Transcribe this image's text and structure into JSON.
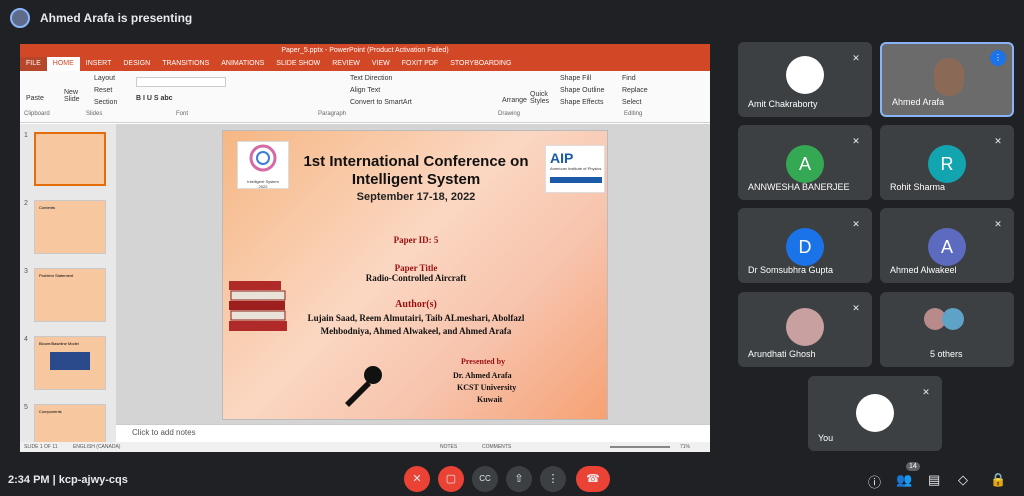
{
  "presenter": {
    "label": "Ahmed Arafa is presenting"
  },
  "powerpoint": {
    "window_title": "Paper_5.pptx - PowerPoint (Product Activation Failed)",
    "tabs": [
      "FILE",
      "HOME",
      "INSERT",
      "DESIGN",
      "TRANSITIONS",
      "ANIMATIONS",
      "SLIDE SHOW",
      "REVIEW",
      "VIEW",
      "FOXIT PDF",
      "STORYBOARDING"
    ],
    "ribbon": {
      "paste": "Paste",
      "new_slide": "New Slide",
      "layout": "Layout",
      "reset": "Reset",
      "section": "Section",
      "text_direction": "Text Direction",
      "align_text": "Align Text",
      "convert_smartart": "Convert to SmartArt",
      "arrange": "Arrange",
      "quick_styles": "Quick Styles",
      "shape_fill": "Shape Fill",
      "shape_outline": "Shape Outline",
      "shape_effects": "Shape Effects",
      "find": "Find",
      "replace": "Replace",
      "select": "Select",
      "groups": [
        "Clipboard",
        "Slides",
        "Font",
        "Paragraph",
        "Drawing",
        "Editing"
      ]
    },
    "thumbnail_numbers": [
      "1",
      "2",
      "3",
      "4",
      "5"
    ],
    "thumbnail_texts": [
      "Contents",
      "Problem Statement",
      "Bloom/Baseline Model",
      "Components"
    ],
    "notes_placeholder": "Click to add notes",
    "status": {
      "slide": "SLIDE 1 OF 11",
      "language": "ENGLISH (CANADA)",
      "notes": "NOTES",
      "comments": "COMMENTS",
      "zoom": "71%"
    }
  },
  "slide": {
    "logo_left": "Intelligent System",
    "logo_left_year": "2022",
    "logo_right": "AIP",
    "logo_right_sub": "American Institute of Physics",
    "title_line1": "1st International Conference on",
    "title_line2": "Intelligent System",
    "date": "September 17-18, 2022",
    "paper_id": "Paper ID: 5",
    "paper_title_label": "Paper Title",
    "paper_title": "Radio-Controlled Aircraft",
    "authors_label": "Author(s)",
    "authors_line1": "Lujain Saad, Reem Almutairi, Taib ALmeshari, Abolfazl",
    "authors_line2": "Mehbodniya, Ahmed Alwakeel, and Ahmed Arafa",
    "presented_by": "Presented by",
    "presenter": "Dr. Ahmed Arafa",
    "university": "KCST University",
    "country": "Kuwait"
  },
  "participants": [
    {
      "name": "Amit Chakraborty",
      "initial": "",
      "color": "#3c4043"
    },
    {
      "name": "Ahmed Arafa",
      "initial": "",
      "color": "#3c4043"
    },
    {
      "name": "ANNWESHA BANERJEE",
      "initial": "A",
      "color": "#34a853"
    },
    {
      "name": "Rohit Sharma",
      "initial": "R",
      "color": "#12a4af"
    },
    {
      "name": "Dr Somsubhra Gupta",
      "initial": "D",
      "color": "#1a73e8"
    },
    {
      "name": "Ahmed Alwakeel",
      "initial": "A",
      "color": "#5c6bc0"
    },
    {
      "name": "Arundhati Ghosh",
      "initial": "",
      "color": "#3c4043"
    },
    {
      "name": "5 others",
      "initial": "",
      "color": "#3c4043"
    },
    {
      "name": "You",
      "initial": "",
      "color": "#3c4043"
    }
  ],
  "bottom": {
    "time": "2:34 PM",
    "meeting_code": "kcp-ajwy-cqs",
    "participant_count": "14"
  }
}
